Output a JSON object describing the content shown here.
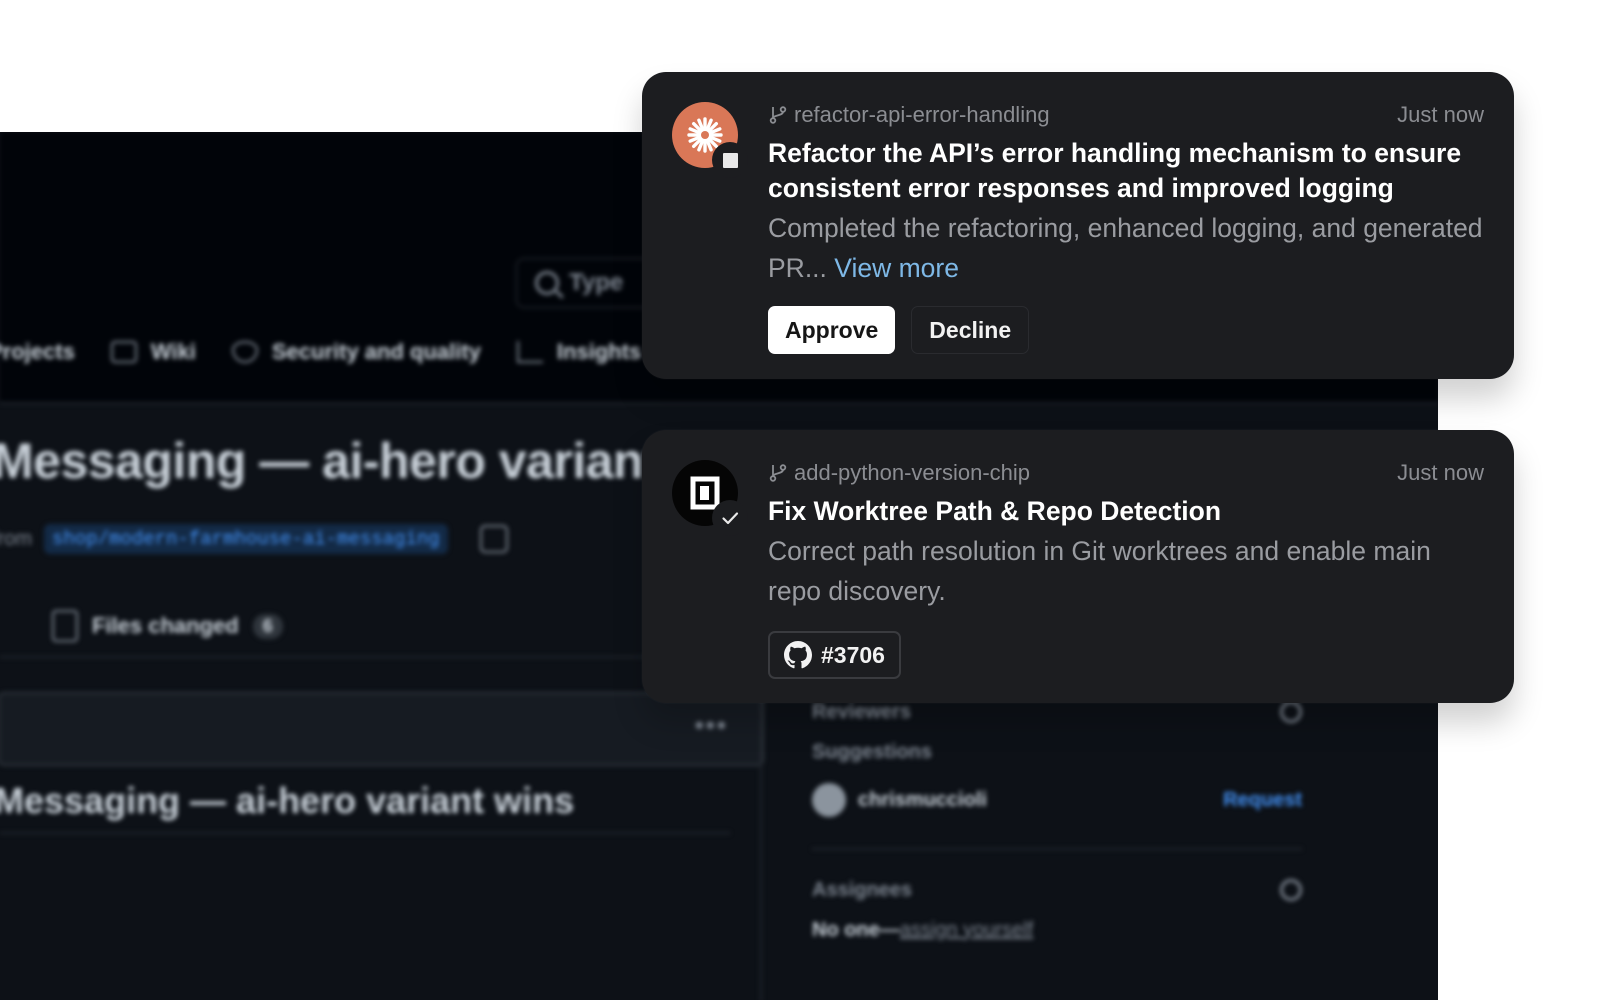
{
  "background": {
    "search_placeholder": "Type",
    "nav": [
      "Projects",
      "Wiki",
      "Security and quality",
      "Insights"
    ],
    "pr_title": "Messaging — ai-hero variant wins",
    "from_label": "from",
    "branch": "shop/modern-farmhouse-ai-messaging",
    "files_changed_label": "Files changed",
    "files_changed_count": "6",
    "commit_title": "Messaging — ai-hero variant wins",
    "reviewers_label": "Reviewers",
    "suggestions_label": "Suggestions",
    "suggested_user": "chrismuccioli",
    "request_label": "Request",
    "assignees_label": "Assignees",
    "no_one_label": "No one—",
    "assign_yourself_label": "assign yourself"
  },
  "notifications": [
    {
      "branch": "refactor-api-error-handling",
      "time": "Just now",
      "title": "Refactor the API’s error handling mechanism to ensure consistent error responses and improved logging",
      "description": "Completed the refactoring, enhanced logging, and generated PR...",
      "view_more": "View more",
      "approve_label": "Approve",
      "decline_label": "Decline",
      "accent_color": "#d97757"
    },
    {
      "branch": "add-python-version-chip",
      "time": "Just now",
      "title": "Fix Worktree Path & Repo Detection",
      "description": "Correct path resolution in Git worktrees and enable main repo discovery.",
      "pr_number": "#3706"
    }
  ]
}
